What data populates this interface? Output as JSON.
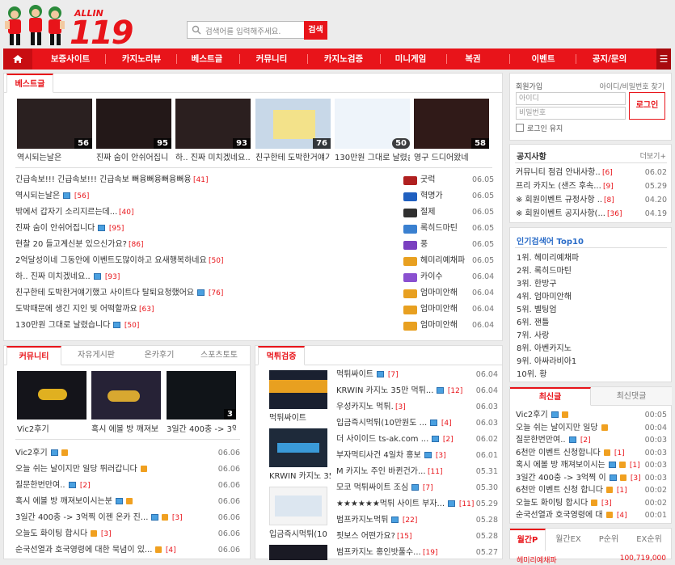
{
  "brand": {
    "small": "ALLIN",
    "big": "119"
  },
  "search": {
    "placeholder": "검색어를 입력해주세요.",
    "button": "검색"
  },
  "nav": [
    "보증사이트",
    "카지노리뷰",
    "베스트글",
    "커뮤니티",
    "카지노검증",
    "미니게임",
    "복권",
    "이벤트",
    "공지/문의"
  ],
  "best": {
    "tab": "베스트글",
    "thumbs": [
      {
        "caption": "역시되는날은",
        "num": ""
      },
      {
        "caption": "진짜 숨이 안쉬어집니",
        "num": "95"
      },
      {
        "caption": "하.. 진짜 미치겠네요..",
        "num": "93"
      },
      {
        "caption": "친구한테 도박한거얘기",
        "num": "76"
      },
      {
        "caption": "130만원 그대로 날렸슴",
        "num": "50"
      },
      {
        "caption": "영구 드디어왔네",
        "num": "58"
      }
    ],
    "first_num": "56",
    "rows": [
      {
        "title": "긴급속보!!! 긴급속보!!! 긴급속보 뻐융뻐융뻐융뻐융",
        "cmt": "[41]",
        "img": false,
        "nick": "굿럭",
        "date": "06.05"
      },
      {
        "title": "역시되는날은",
        "cmt": "[56]",
        "img": true,
        "nick": "혁명가",
        "date": "06.05"
      },
      {
        "title": "밖에서 갑자기 소리지르는데...",
        "cmt": "[40]",
        "img": false,
        "nick": "절제",
        "date": "06.05"
      },
      {
        "title": "진짜 숨이 안쉬어집니다",
        "cmt": "[95]",
        "img": true,
        "nick": "록히드마틴",
        "date": "06.05"
      },
      {
        "title": "현찰 20 들고계신분 있으신가요?",
        "cmt": "[86]",
        "img": false,
        "nick": "풍",
        "date": "06.05"
      },
      {
        "title": "2억달성이네 그동안에 이벤트도많이하고 요새행복하네요",
        "cmt": "[50]",
        "img": false,
        "nick": "헤미리예채파",
        "date": "06.05"
      },
      {
        "title": "하.. 진짜 미치겠네요..",
        "cmt": "[93]",
        "img": true,
        "nick": "카이수",
        "date": "06.04"
      },
      {
        "title": "친구한테 도박한거얘기했고 사이트다 탈퇴요청했어요",
        "cmt": "[76]",
        "img": true,
        "nick": "엄마미안해",
        "date": "06.04"
      },
      {
        "title": "도박때문에 생긴 지인 빚 어떡할까요",
        "cmt": "[63]",
        "img": false,
        "nick": "엄마미안해",
        "date": "06.04"
      },
      {
        "title": "130만원 그대로 날렸습니다",
        "cmt": "[50]",
        "img": true,
        "nick": "엄마미안해",
        "date": "06.04"
      }
    ]
  },
  "community": {
    "tabs": [
      "커뮤니티",
      "자유게시판",
      "온카후기",
      "스포츠토토"
    ],
    "thumbs": [
      {
        "caption": "Vic2후기",
        "num": ""
      },
      {
        "caption": "혹시 에볼 방 깨져보",
        "num": ""
      },
      {
        "caption": "3일간 400충 -> 3억",
        "num": "3"
      }
    ],
    "rows": [
      {
        "title": "Vic2후기",
        "cmt": "",
        "img": true,
        "new": true,
        "date": "06.06"
      },
      {
        "title": "오늘 쉬는 날이지만 일당 뛰러갑니다",
        "cmt": "",
        "img": false,
        "new": true,
        "date": "06.06"
      },
      {
        "title": "질문한번만여..",
        "cmt": "[2]",
        "img": true,
        "new": false,
        "date": "06.06"
      },
      {
        "title": "혹시 에볼 방 깨져보이시는분",
        "cmt": "",
        "img": true,
        "new": true,
        "date": "06.06"
      },
      {
        "title": "3일간 400충 -> 3억찍 이젠 온카 진...",
        "cmt": "[3]",
        "img": true,
        "new": true,
        "date": "06.06"
      },
      {
        "title": "오늘도 화이팅 합시다",
        "cmt": "[3]",
        "img": false,
        "new": true,
        "date": "06.06"
      },
      {
        "title": "순국선열과 호국영령에 대한 묵념이 있...",
        "cmt": "[4]",
        "img": false,
        "new": true,
        "date": "06.06"
      }
    ]
  },
  "verify": {
    "tab": "먹튀검증",
    "thumbs": [
      {
        "caption": "먹튀싸이트"
      },
      {
        "caption": "KRWIN 카지노 35"
      },
      {
        "caption": "입금즉시먹튀(10"
      }
    ],
    "rows": [
      {
        "title": "먹튀싸이트",
        "cmt": "[7]",
        "img": true,
        "date": "06.04"
      },
      {
        "title": "KRWIN 카지노 35만 먹튀...",
        "cmt": "[12]",
        "img": true,
        "date": "06.04"
      },
      {
        "title": "우성카지노 먹튀.",
        "cmt": "[3]",
        "img": false,
        "date": "06.03"
      },
      {
        "title": "입금즉시먹튀(10만원도 ...",
        "cmt": "[4]",
        "img": true,
        "date": "06.03"
      },
      {
        "title": "더 사이이드 ts-ak.com ...",
        "cmt": "[2]",
        "img": true,
        "date": "06.02"
      },
      {
        "title": "부자먹티사건 4일차 홍보",
        "cmt": "[3]",
        "img": true,
        "date": "06.01"
      },
      {
        "title": "M 카지노 주인 바뀐건가...",
        "cmt": "[11]",
        "img": false,
        "date": "05.31"
      },
      {
        "title": "모코 먹튀싸이트 조심",
        "cmt": "[7]",
        "img": true,
        "date": "05.30"
      },
      {
        "title": "★★★★★★먹튀 사이트 부자...",
        "cmt": "[11]",
        "img": true,
        "date": "05.29"
      },
      {
        "title": "범프카지노먹튀",
        "cmt": "[22]",
        "img": true,
        "date": "05.28"
      },
      {
        "title": "핏보스 어떤가요?",
        "cmt": "[15]",
        "img": false,
        "date": "05.28"
      },
      {
        "title": "범프카지노 홍인밧풀수...",
        "cmt": "[19]",
        "img": false,
        "date": "05.27"
      }
    ]
  },
  "login": {
    "title": "회원가입",
    "find": "아이디/비밀번호 찾기",
    "id_ph": "아이디",
    "pw_ph": "비밀번호",
    "button": "로그인",
    "keep": "로그인 유지"
  },
  "notice": {
    "title": "공지사항",
    "more": "더보기+",
    "rows": [
      {
        "title": "커뮤니티 점검 안내사항..",
        "cmt": "[6]",
        "date": "06.02"
      },
      {
        "title": "프리 카지노 (샌즈 후속...",
        "cmt": "[9]",
        "date": "05.29"
      },
      {
        "title": "※ 회원이벤트 규정사항 ..",
        "cmt": "[8]",
        "date": "04.20"
      },
      {
        "title": "※ 회원이벤트 공지사항(...",
        "cmt": "[36]",
        "date": "04.19"
      }
    ]
  },
  "popular": {
    "title": "인기검색어 Top10",
    "items": [
      "1위. 헤미리예채파",
      "2위. 록히드마틴",
      "3위. 한방구",
      "4위. 엄마미안해",
      "5위. 벨팅엄",
      "6위. 잰틀",
      "7위. 사랑",
      "8위. 아벤카지노",
      "9위. 아싸라비아1",
      "10위. 황"
    ]
  },
  "latest": {
    "tabs": [
      "최신글",
      "최신댓글"
    ],
    "rows": [
      {
        "title": "Vic2후기",
        "cmt": "",
        "img": true,
        "new": true,
        "date": "00:05"
      },
      {
        "title": "오늘 쉬는 날이지만 일당",
        "cmt": "",
        "img": false,
        "new": true,
        "date": "00:04"
      },
      {
        "title": "질문한번만여..",
        "cmt": "[2]",
        "img": true,
        "new": false,
        "date": "00:03"
      },
      {
        "title": "6천만 이벤트 신청합니다",
        "cmt": "[1]",
        "img": false,
        "new": true,
        "date": "00:03"
      },
      {
        "title": "혹시 에볼 방 깨져보이시는",
        "cmt": "[1]",
        "img": true,
        "new": true,
        "date": "00:03"
      },
      {
        "title": "3일간 400충 -> 3억찍 이",
        "cmt": "[3]",
        "img": true,
        "new": true,
        "date": "00:03"
      },
      {
        "title": "6천만 이벤트 신청 합니다",
        "cmt": "[1]",
        "img": false,
        "new": true,
        "date": "00:02"
      },
      {
        "title": "오늘도 화이팅 합시다",
        "cmt": "[3]",
        "img": false,
        "new": true,
        "date": "00:02"
      },
      {
        "title": "순국선열과 호국영령에 대",
        "cmt": "[4]",
        "img": false,
        "new": true,
        "date": "00:01"
      }
    ]
  },
  "rank": {
    "tabs": [
      "월간P",
      "월간EX",
      "P순위",
      "EX순위"
    ],
    "first": "헤미리예채파",
    "first_val": "100,719,000"
  }
}
